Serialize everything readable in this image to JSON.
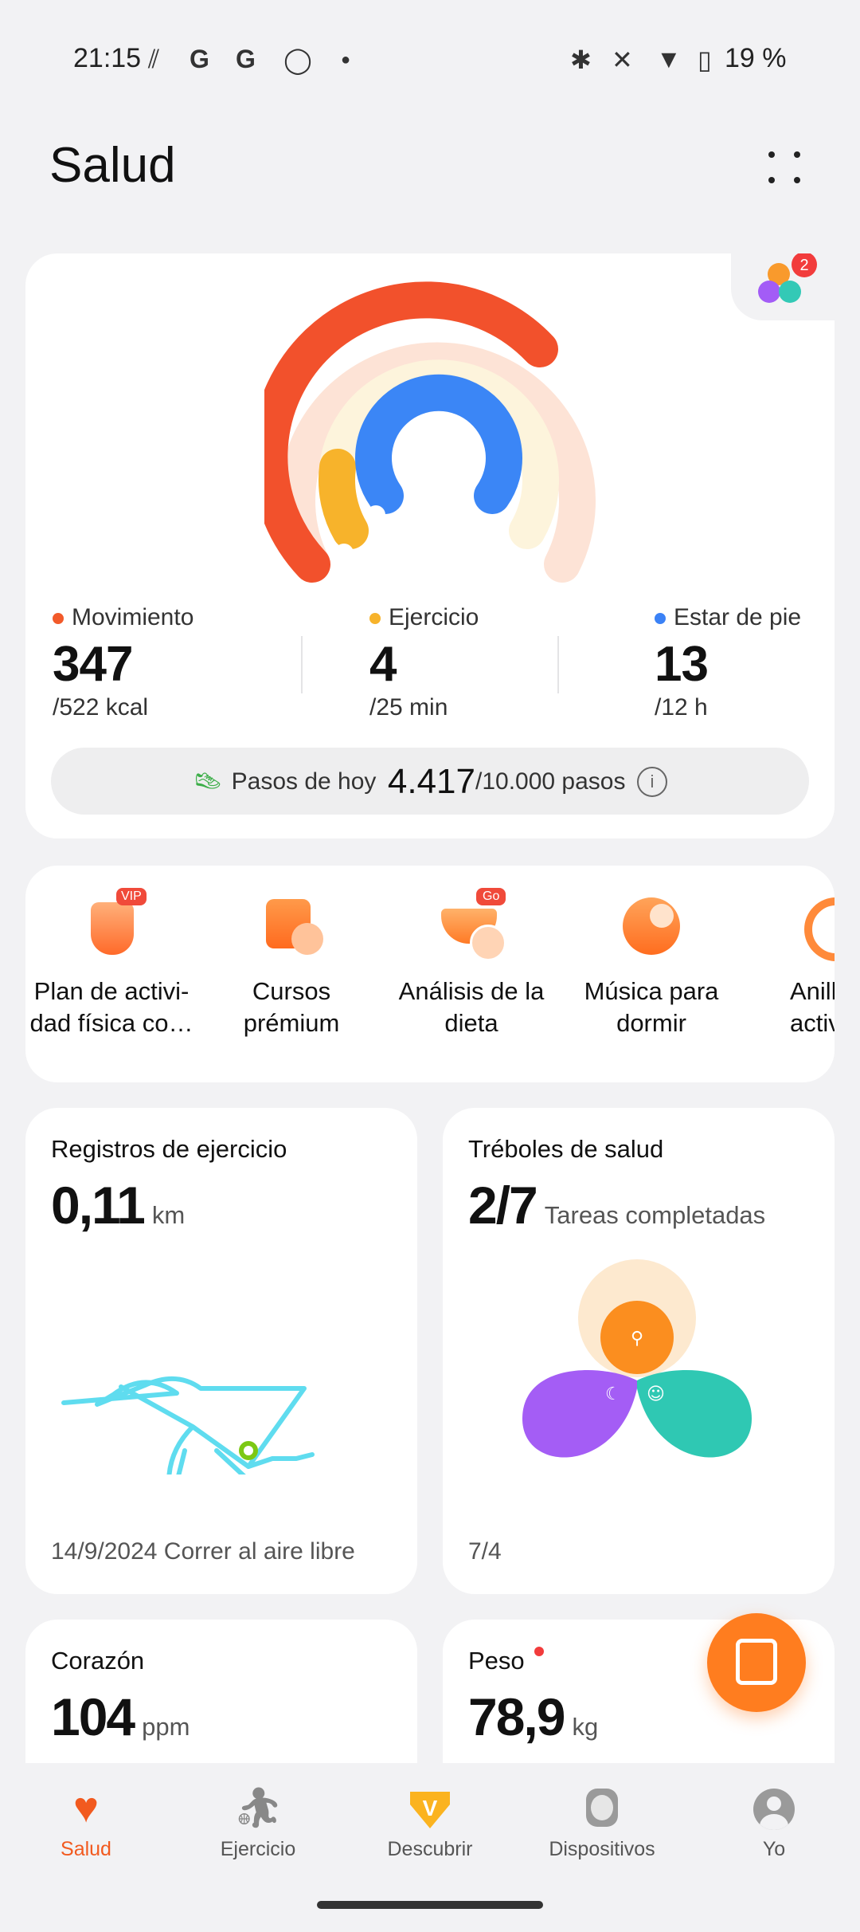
{
  "status_bar": {
    "time": "21:15",
    "battery": "19 %"
  },
  "header": {
    "title": "Salud"
  },
  "activity": {
    "badge_count": "2",
    "metrics": [
      {
        "label": "Movimiento",
        "value": "347",
        "goal": "/522 kcal",
        "color": "#f25a2a"
      },
      {
        "label": "Ejercicio",
        "value": "4",
        "goal": "/25 min",
        "color": "#f7b32b"
      },
      {
        "label": "Estar de pie",
        "value": "13",
        "goal": "/12 h",
        "color": "#3b82f6"
      }
    ],
    "steps": {
      "label": "Pasos de hoy",
      "value": "4.417",
      "goal": "/10.000 pasos"
    }
  },
  "shortcuts": [
    {
      "label": "Plan de activi-\ndad física co…",
      "tag": "VIP"
    },
    {
      "label": "Cursos\nprémium"
    },
    {
      "label": "Análisis de la\ndieta",
      "tag": "Go"
    },
    {
      "label": "Música para\ndormir"
    },
    {
      "label": "Anillo\nactiv"
    }
  ],
  "exercise": {
    "title": "Registros de ejercicio",
    "value": "0,11",
    "unit": "km",
    "footer": "14/9/2024 Correr al aire libre"
  },
  "clover": {
    "title": "Tréboles de salud",
    "value": "2/7",
    "unit": "Tareas completadas",
    "footer": "7/4"
  },
  "heart": {
    "title": "Corazón",
    "value": "104",
    "unit": "ppm"
  },
  "weight": {
    "title": "Peso",
    "value": "78,9",
    "unit": "kg"
  },
  "nav": [
    {
      "label": "Salud",
      "icon": "heart-pulse-icon"
    },
    {
      "label": "Ejercicio",
      "icon": "runner-icon"
    },
    {
      "label": "Descubrir",
      "icon": "vip-v-icon"
    },
    {
      "label": "Dispositivos",
      "icon": "watch-icon"
    },
    {
      "label": "Yo",
      "icon": "profile-icon"
    }
  ],
  "colors": {
    "accent": "#f25a1f",
    "move": "#f25a2a",
    "exercise": "#f7b32b",
    "stand": "#3b82f6"
  }
}
